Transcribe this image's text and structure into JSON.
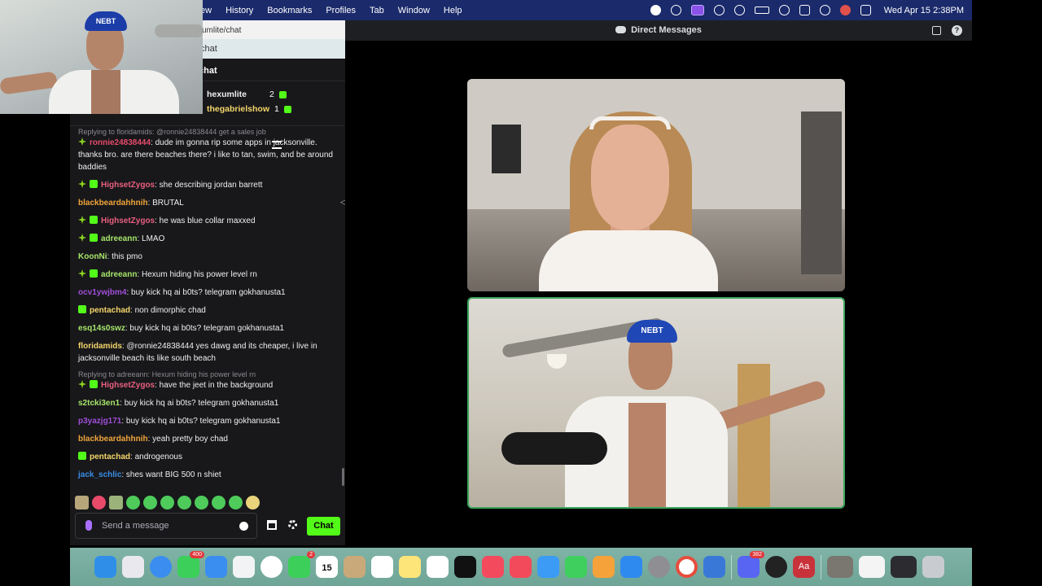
{
  "menubar": {
    "menus": [
      "ew",
      "History",
      "Bookmarks",
      "Profiles",
      "Tab",
      "Window",
      "Help"
    ],
    "clock": "Wed Apr 15  2:38PM"
  },
  "browser": {
    "url": "umlite/chat",
    "tab_label": "chat",
    "chat_header": "chat",
    "leaders": [
      {
        "name": "hexumlite",
        "count": "2"
      },
      {
        "name": "thegabrielshow",
        "count": "1"
      }
    ]
  },
  "chat": {
    "messages": [
      {
        "reply": "Replying to floridamids: @ronnie24838444 get a sales job",
        "badges": [
          "star"
        ],
        "user": "ronnie24838444",
        "color": "#e84a6a",
        "text": ": dude im gonna rip some apps in jacksonville. thanks bro. are there beaches there? i like to tan, swim, and be around baddies"
      },
      {
        "badges": [
          "star",
          "gift"
        ],
        "user": "HighsetZygos",
        "color": "#e85f7f",
        "text": ": she describing jordan barrett"
      },
      {
        "badges": [],
        "user": "blackbeardahhnih",
        "color": "#f0a53a",
        "text": ": BRUTAL"
      },
      {
        "badges": [
          "star",
          "gift"
        ],
        "user": "HighsetZygos",
        "color": "#e85f7f",
        "text": ": he was blue collar maxxed"
      },
      {
        "badges": [
          "star",
          "gift"
        ],
        "user": "adreeann",
        "color": "#a6e46a",
        "text": ": LMAO"
      },
      {
        "badges": [],
        "user": "KoonNi",
        "color": "#a6e46a",
        "text": ": this pmo"
      },
      {
        "badges": [
          "star",
          "gift"
        ],
        "user": "adreeann",
        "color": "#a6e46a",
        "text": ": Hexum hiding his power level rn"
      },
      {
        "badges": [],
        "user": "ocv1ywjbm4",
        "color": "#a04ed8",
        "text": ": buy kick hq ai b0ts? telegram gokhanusta1"
      },
      {
        "badges": [
          "gift"
        ],
        "user": "pentachad",
        "color": "#f5d66a",
        "text": ": non dimorphic chad"
      },
      {
        "badges": [],
        "user": "esq14s0swz",
        "color": "#a6e46a",
        "text": ": buy kick hq ai b0ts? telegram gokhanusta1"
      },
      {
        "badges": [],
        "user": "floridamids",
        "color": "#f5d66a",
        "text": ": @ronnie24838444 yes dawg and its cheaper, i live in jacksonville beach its like south beach"
      },
      {
        "reply": "Replying to adreeann: Hexum hiding his power level rn",
        "badges": [
          "star",
          "gift"
        ],
        "user": "HighsetZygos",
        "color": "#e85f7f",
        "text": ": have the jeet in the background"
      },
      {
        "badges": [],
        "user": "s2tcki3en1",
        "color": "#a6e46a",
        "text": ": buy kick hq ai b0ts? telegram gokhanusta1"
      },
      {
        "badges": [],
        "user": "p3yazjg171",
        "color": "#a04ed8",
        "text": ": buy kick hq ai b0ts? telegram gokhanusta1"
      },
      {
        "badges": [],
        "user": "blackbeardahhnih",
        "color": "#f0a53a",
        "text": ": yeah pretty boy chad"
      },
      {
        "badges": [
          "gift"
        ],
        "user": "pentachad",
        "color": "#f5d66a",
        "text": ": androgenous"
      },
      {
        "badges": [],
        "user": "jack_schlic",
        "color": "#3a8ee6",
        "text": ": shes want BIG 500 n shiet"
      }
    ],
    "input_placeholder": "Send a message",
    "chat_button": "Chat"
  },
  "webcam": {
    "cap_text": "NEBT"
  },
  "discord": {
    "title": "Direct Messages",
    "help": "?",
    "tile2_cap": "NEBT"
  },
  "dock": {
    "badges": {
      "messages": "400",
      "facetime": "2",
      "discord": "382"
    },
    "calendar_day": "15",
    "dictionary": "Aa"
  },
  "colors": {
    "accent_green": "#53fc18",
    "chat_bg": "#18181b",
    "speaking_border": "#3ba55d"
  }
}
